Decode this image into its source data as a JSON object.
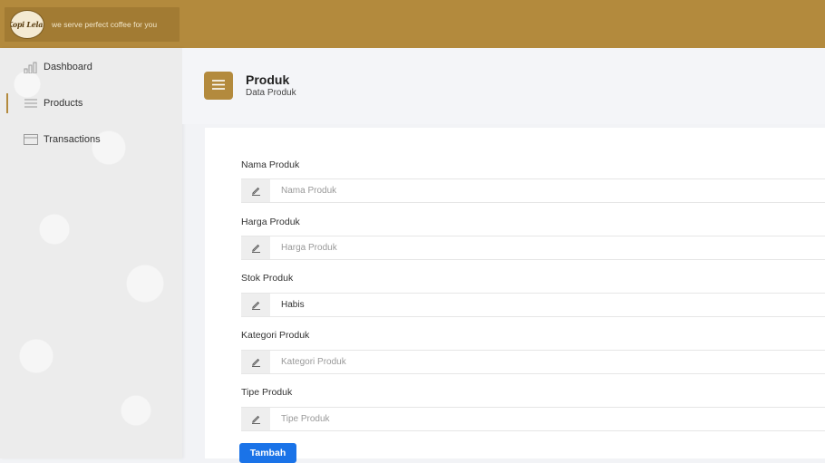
{
  "brand": {
    "logo_text": "Kopi Lelah",
    "tagline": "we serve perfect coffee for you"
  },
  "sidebar": {
    "items": [
      {
        "label": "Dashboard",
        "icon": "bar-chart-icon",
        "active": false
      },
      {
        "label": "Products",
        "icon": "list-icon",
        "active": true
      },
      {
        "label": "Transactions",
        "icon": "card-icon",
        "active": false
      }
    ]
  },
  "header": {
    "title": "Produk",
    "subtitle": "Data Produk",
    "menu_icon": "hamburger-icon"
  },
  "form": {
    "fields": [
      {
        "label": "Nama Produk",
        "placeholder": "Nama Produk",
        "value": ""
      },
      {
        "label": "Harga Produk",
        "placeholder": "Harga Produk",
        "value": ""
      },
      {
        "label": "Stok Produk",
        "placeholder": "",
        "value": "Habis"
      },
      {
        "label": "Kategori Produk",
        "placeholder": "Kategori Produk",
        "value": ""
      },
      {
        "label": "Tipe Produk",
        "placeholder": "Tipe Produk",
        "value": ""
      }
    ],
    "submit_label": "Tambah"
  },
  "colors": {
    "brand": "#b38a3d",
    "primary_button": "#1a73e8"
  }
}
